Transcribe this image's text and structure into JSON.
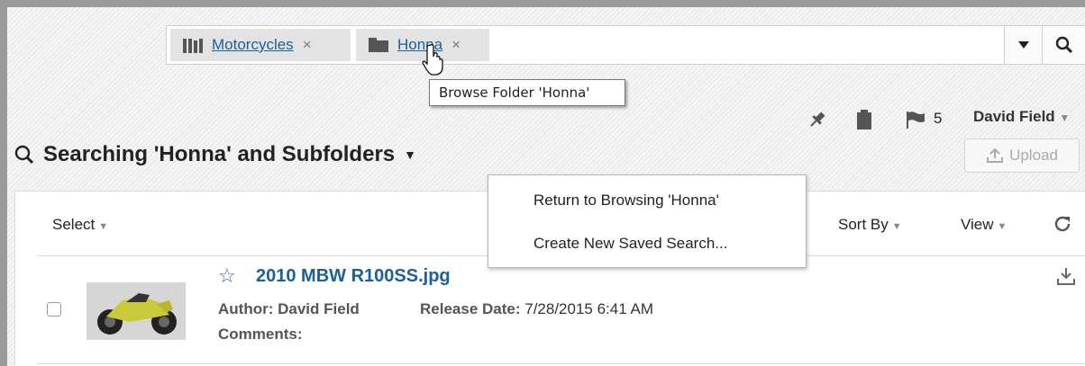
{
  "search": {
    "chips": [
      {
        "label": "Motorcycles",
        "remove": "×",
        "icon": "library-icon"
      },
      {
        "label": "Honna",
        "remove": "×",
        "icon": "folder-icon"
      }
    ],
    "tooltip": "Browse Folder 'Honna'"
  },
  "toolbar": {
    "flag_count": "5",
    "user_name": "David Field",
    "user_caret": "▼"
  },
  "heading": {
    "title": "Searching 'Honna' and Subfolders",
    "caret": "▼"
  },
  "upload_label": "Upload",
  "list_header": {
    "select": "Select",
    "sort_by": "Sort By",
    "view": "View",
    "caret": "▼"
  },
  "dropdown_menu": {
    "items": [
      "Return to Browsing 'Honna'",
      "Create New Saved Search..."
    ]
  },
  "result": {
    "filename": "2010 MBW R100SS.jpg",
    "author_label": "Author:",
    "author": "David Field",
    "release_label": "Release Date:",
    "release_date": "7/28/2015 6:41 AM",
    "comments_label": "Comments:"
  },
  "colors": {
    "link": "#1a5f9e",
    "star": "#2f6fb8"
  }
}
